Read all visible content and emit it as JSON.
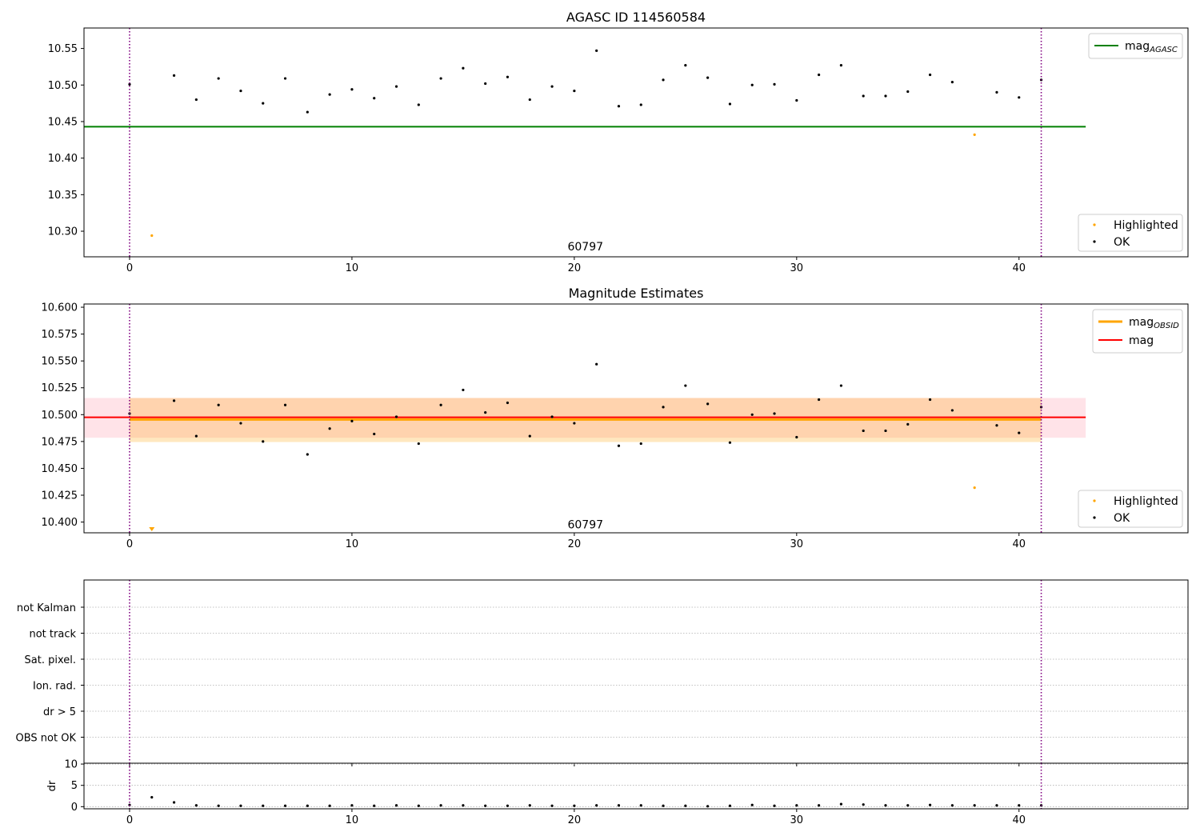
{
  "chart_data": [
    {
      "type": "scatter",
      "title": "AGASC ID 114560584",
      "xlabel": "",
      "ylabel": "",
      "xlim": [
        -2.05,
        47.6
      ],
      "ylim": [
        10.265,
        10.578
      ],
      "xticks": [
        0,
        10,
        20,
        30,
        40
      ],
      "yticks": [
        10.3,
        10.35,
        10.4,
        10.45,
        10.5,
        10.55
      ],
      "ytick_labels": [
        "10.30",
        "10.35",
        "10.40",
        "10.45",
        "10.50",
        "10.55"
      ],
      "grid": false,
      "vlines": [
        0,
        41
      ],
      "annotation": {
        "text": "60797",
        "x": 20.5,
        "y": 10.274
      },
      "lines": [
        {
          "name": "mag_AGASC",
          "legend_main": "mag",
          "legend_sub": "AGASC",
          "color": "#008000",
          "y": 10.443,
          "x": [
            -2.05,
            43.0
          ]
        }
      ],
      "series": [
        {
          "name": "Highlighted",
          "color": "#ffa500",
          "x": [
            1,
            38
          ],
          "y": [
            10.294,
            10.432
          ]
        },
        {
          "name": "OK",
          "color": "#000000",
          "x": [
            0,
            2,
            3,
            4,
            5,
            6,
            7,
            8,
            9,
            10,
            11,
            12,
            13,
            14,
            15,
            16,
            17,
            18,
            19,
            20,
            21,
            22,
            23,
            24,
            25,
            26,
            27,
            28,
            29,
            30,
            31,
            32,
            33,
            34,
            35,
            36,
            37,
            39,
            40,
            41
          ],
          "y": [
            10.501,
            10.513,
            10.48,
            10.509,
            10.492,
            10.475,
            10.509,
            10.463,
            10.487,
            10.494,
            10.482,
            10.498,
            10.473,
            10.509,
            10.523,
            10.502,
            10.511,
            10.48,
            10.498,
            10.492,
            10.547,
            10.471,
            10.473,
            10.507,
            10.527,
            10.51,
            10.474,
            10.5,
            10.501,
            10.479,
            10.514,
            10.527,
            10.485,
            10.485,
            10.491,
            10.514,
            10.504,
            10.49,
            10.483,
            10.507
          ]
        }
      ],
      "legend_top_right": [
        "mag_AGASC"
      ],
      "legend_bottom_right": [
        "Highlighted",
        "OK"
      ]
    },
    {
      "type": "scatter",
      "title": "Magnitude Estimates",
      "xlabel": "",
      "ylabel": "",
      "xlim": [
        -2.05,
        47.6
      ],
      "ylim": [
        10.39,
        10.603
      ],
      "xticks": [
        0,
        10,
        20,
        30,
        40
      ],
      "yticks": [
        10.4,
        10.425,
        10.45,
        10.475,
        10.5,
        10.525,
        10.55,
        10.575,
        10.6
      ],
      "ytick_labels": [
        "10.400",
        "10.425",
        "10.450",
        "10.475",
        "10.500",
        "10.525",
        "10.550",
        "10.575",
        "10.600"
      ],
      "grid": false,
      "vlines": [
        0,
        41
      ],
      "annotation": {
        "text": "60797",
        "x": 20.5,
        "y": 10.397
      },
      "bands": [
        {
          "color": "#ffc0cb",
          "opacity": 0.45,
          "x": [
            -2.05,
            43.0
          ],
          "y": [
            10.4785,
            10.5155
          ]
        },
        {
          "color": "#ffa500",
          "opacity": 0.25,
          "x": [
            0,
            41
          ],
          "y": [
            10.4745,
            10.5155
          ]
        }
      ],
      "lines": [
        {
          "name": "mag_OBSID",
          "legend_main": "mag",
          "legend_sub": "OBSID",
          "color": "#ffa500",
          "y": 10.4955,
          "x": [
            0,
            41
          ],
          "width": 3
        },
        {
          "name": "mag",
          "legend_main": "mag",
          "legend_sub": "",
          "color": "#ff0000",
          "y": 10.4975,
          "x": [
            -2.05,
            43.0
          ],
          "width": 2
        }
      ],
      "series": [
        {
          "name": "Highlighted",
          "color": "#ffa500",
          "x": [
            38
          ],
          "y": [
            10.432
          ]
        },
        {
          "name": "OK",
          "color": "#000000",
          "x": [
            0,
            2,
            3,
            4,
            5,
            6,
            7,
            8,
            9,
            10,
            11,
            12,
            13,
            14,
            15,
            16,
            17,
            18,
            19,
            20,
            21,
            22,
            23,
            24,
            25,
            26,
            27,
            28,
            29,
            30,
            31,
            32,
            33,
            34,
            35,
            36,
            37,
            39,
            40,
            41
          ],
          "y": [
            10.501,
            10.513,
            10.48,
            10.509,
            10.492,
            10.475,
            10.509,
            10.463,
            10.487,
            10.494,
            10.482,
            10.498,
            10.473,
            10.509,
            10.523,
            10.502,
            10.511,
            10.48,
            10.498,
            10.492,
            10.547,
            10.471,
            10.473,
            10.507,
            10.527,
            10.51,
            10.474,
            10.5,
            10.501,
            10.479,
            10.514,
            10.527,
            10.485,
            10.485,
            10.491,
            10.514,
            10.504,
            10.49,
            10.483,
            10.507
          ]
        }
      ],
      "offscale_markers": [
        {
          "color": "#ffa500",
          "x": 1
        }
      ],
      "legend_top_right": [
        "mag_OBSID",
        "mag"
      ],
      "legend_bottom_right": [
        "Highlighted",
        "OK"
      ]
    },
    {
      "type": "table",
      "title": "",
      "xlim": [
        -2.05,
        47.6
      ],
      "xticks": [
        0,
        10,
        20,
        30,
        40
      ],
      "categories": [
        "not Kalman",
        "not track",
        "Sat. pixel.",
        "Ion. rad.",
        "dr > 5",
        "OBS not OK"
      ],
      "grid": true,
      "vlines": [
        0,
        41
      ],
      "flags": []
    },
    {
      "type": "scatter",
      "title": "",
      "xlabel": "",
      "ylabel": "dr",
      "xlim": [
        -2.05,
        47.6
      ],
      "ylim": [
        -0.5,
        10.2
      ],
      "xticks": [
        0,
        10,
        20,
        30,
        40
      ],
      "yticks": [
        0,
        5,
        10
      ],
      "ytick_labels": [
        "0",
        "5",
        "10"
      ],
      "grid": true,
      "vlines": [
        0,
        41
      ],
      "series": [
        {
          "name": "dr",
          "color": "#000000",
          "x": [
            0,
            1,
            2,
            3,
            4,
            5,
            6,
            7,
            8,
            9,
            10,
            11,
            12,
            13,
            14,
            15,
            16,
            17,
            18,
            19,
            20,
            21,
            22,
            23,
            24,
            25,
            26,
            27,
            28,
            29,
            30,
            31,
            32,
            33,
            34,
            35,
            36,
            37,
            38,
            39,
            40,
            41
          ],
          "y": [
            0.4,
            2.2,
            1.0,
            0.3,
            0.2,
            0.2,
            0.2,
            0.2,
            0.2,
            0.2,
            0.3,
            0.2,
            0.3,
            0.2,
            0.3,
            0.3,
            0.2,
            0.2,
            0.3,
            0.2,
            0.2,
            0.3,
            0.3,
            0.3,
            0.2,
            0.2,
            0.1,
            0.2,
            0.4,
            0.2,
            0.3,
            0.3,
            0.6,
            0.5,
            0.3,
            0.3,
            0.4,
            0.3,
            0.3,
            0.3,
            0.3,
            0.3
          ]
        }
      ]
    }
  ]
}
